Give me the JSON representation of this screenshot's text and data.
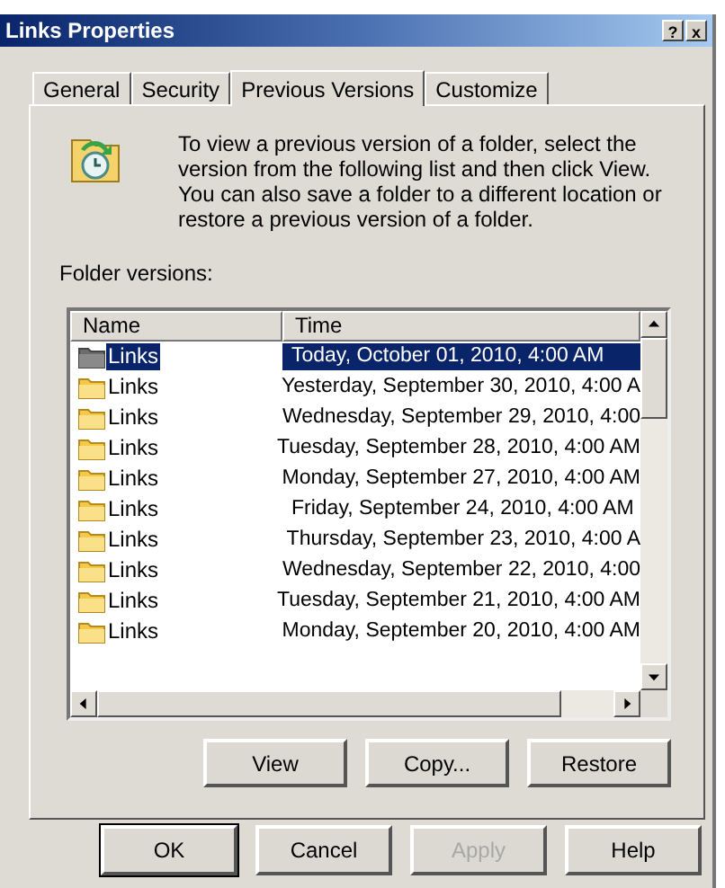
{
  "window": {
    "title": "Links Properties",
    "controls": [
      "?",
      "x"
    ]
  },
  "tabs": [
    {
      "label": "General",
      "selected": false
    },
    {
      "label": "Security",
      "selected": false
    },
    {
      "label": "Previous Versions",
      "selected": true
    },
    {
      "label": "Customize",
      "selected": false
    }
  ],
  "description": "To view a previous version of a folder, select the version from the following list and then click View. You can also save a folder to a different location or restore a previous version of a folder.",
  "list_label": "Folder versions:",
  "table": {
    "columns": [
      "Name",
      "Time"
    ],
    "rows": [
      {
        "name": "Links",
        "time": "Today, October 01, 2010, 4:00 AM",
        "selected": true
      },
      {
        "name": "Links",
        "time": "Yesterday, September 30, 2010, 4:00 A",
        "selected": false
      },
      {
        "name": "Links",
        "time": "Wednesday, September 29, 2010, 4:00",
        "selected": false
      },
      {
        "name": "Links",
        "time": "Tuesday, September 28, 2010, 4:00 AM",
        "selected": false
      },
      {
        "name": "Links",
        "time": "Monday, September 27, 2010, 4:00 AM",
        "selected": false
      },
      {
        "name": "Links",
        "time": "Friday, September 24, 2010, 4:00 AM",
        "selected": false
      },
      {
        "name": "Links",
        "time": "Thursday, September 23, 2010, 4:00 A",
        "selected": false
      },
      {
        "name": "Links",
        "time": "Wednesday, September 22, 2010, 4:00",
        "selected": false
      },
      {
        "name": "Links",
        "time": "Tuesday, September 21, 2010, 4:00 AM",
        "selected": false
      },
      {
        "name": "Links",
        "time": "Monday, September 20, 2010, 4:00 AM",
        "selected": false
      }
    ]
  },
  "panel_buttons": [
    {
      "label": "View",
      "disabled": false
    },
    {
      "label": "Copy...",
      "disabled": false
    },
    {
      "label": "Restore",
      "disabled": false
    }
  ],
  "dialog_buttons": [
    {
      "label": "OK",
      "disabled": false,
      "default": true
    },
    {
      "label": "Cancel",
      "disabled": false,
      "default": false
    },
    {
      "label": "Apply",
      "disabled": true,
      "default": false
    },
    {
      "label": "Help",
      "disabled": false,
      "default": false
    }
  ]
}
